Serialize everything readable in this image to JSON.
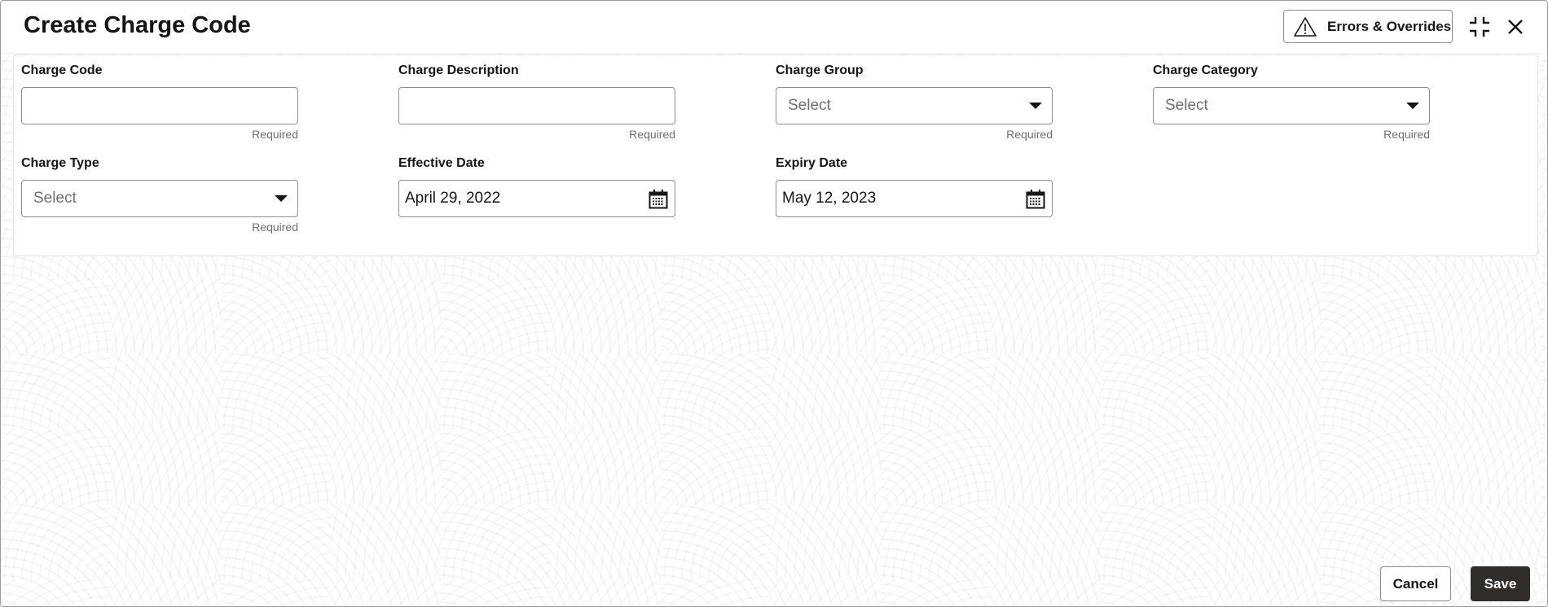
{
  "header": {
    "title": "Create Charge Code",
    "errors_button": {
      "label": "Errors & Overrides",
      "icon": "warning-triangle-icon"
    },
    "minimize_icon": "compress-icon",
    "close_icon": "close-icon"
  },
  "form": {
    "fields": [
      {
        "label": "Charge Code",
        "type": "text",
        "value": "",
        "helper": "Required"
      },
      {
        "label": "Charge Description",
        "type": "text",
        "value": "",
        "helper": "Required"
      },
      {
        "label": "Charge Group",
        "type": "select",
        "placeholder": "Select",
        "helper": "Required"
      },
      {
        "label": "Charge Category",
        "type": "select",
        "placeholder": "Select",
        "helper": "Required"
      },
      {
        "label": "Charge Type",
        "type": "select",
        "placeholder": "Select",
        "helper": "Required"
      },
      {
        "label": "Effective Date",
        "type": "date",
        "value": "April 29, 2022",
        "icon": "calendar-icon"
      },
      {
        "label": "Expiry Date",
        "type": "date",
        "value": "May 12, 2023",
        "icon": "calendar-icon"
      }
    ]
  },
  "footer": {
    "cancel_label": "Cancel",
    "save_label": "Save"
  },
  "colors": {
    "primary_button": "#312d2a",
    "text": "#161513",
    "muted_text": "#6f6f6f"
  }
}
